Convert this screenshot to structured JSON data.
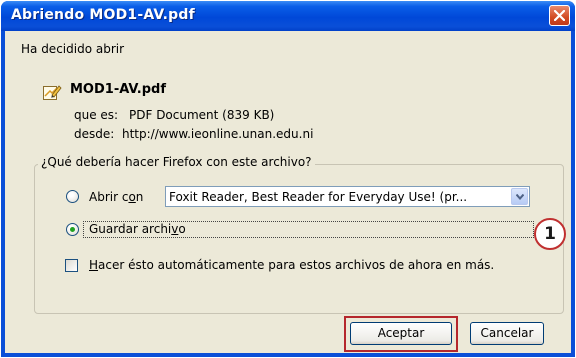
{
  "window": {
    "title": "Abriendo MOD1-AV.pdf"
  },
  "intro": {
    "text": "Ha decidido abrir"
  },
  "file": {
    "name": "MOD1-AV.pdf",
    "type_label": "que es:",
    "type_value": "PDF Document (839 KB)",
    "from_label": "desde:",
    "from_value": "http://www.ieonline.unan.edu.ni"
  },
  "options": {
    "group_label": "¿Qué debería hacer Firefox con este archivo?",
    "open_with_prefix": "Abrir c",
    "open_with_accel": "o",
    "open_with_suffix": "n",
    "open_with_selected": false,
    "application_value": "Foxit Reader, Best Reader for Everyday Use! (pr...",
    "save_prefix": "Guardar archi",
    "save_accel": "v",
    "save_suffix": "o",
    "save_selected": true,
    "auto_accel": "H",
    "auto_rest": "acer ésto automáticamente para estos archivos de ahora en más.",
    "auto_checked": false
  },
  "annotation": {
    "number": "1"
  },
  "buttons": {
    "accept": "Aceptar",
    "cancel": "Cancelar"
  },
  "colors": {
    "title_bar": "#0a4fd8",
    "close_button": "#d24b22",
    "annotation_red": "#b5272c",
    "radio_dot": "#21a121"
  }
}
